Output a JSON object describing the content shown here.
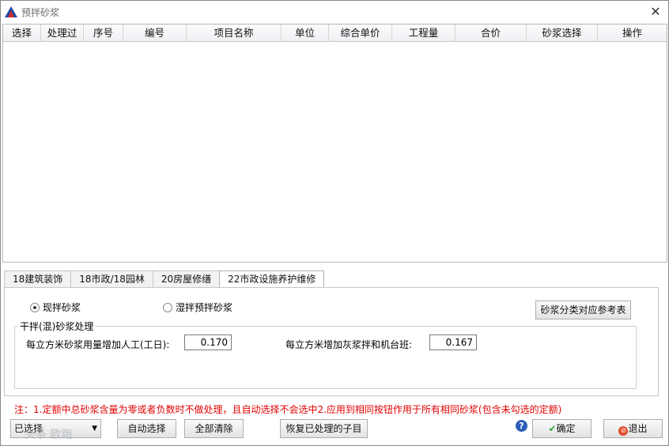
{
  "window": {
    "title": "预拌砂浆",
    "close_glyph": "✕"
  },
  "grid": {
    "columns": [
      "选择",
      "处理过",
      "序号",
      "编号",
      "项目名称",
      "单位",
      "综合单价",
      "工程量",
      "合价",
      "砂浆选择",
      "操作"
    ]
  },
  "tabs": [
    {
      "label": "18建筑装饰",
      "active": false
    },
    {
      "label": "18市政/18园林",
      "active": false
    },
    {
      "label": "20房屋修缮",
      "active": false
    },
    {
      "label": "22市政设施养护维修",
      "active": true
    }
  ],
  "panel": {
    "radio_site_mix": {
      "label": "现拌砂浆",
      "checked": true
    },
    "radio_wet_mix": {
      "label": "湿拌预拌砂浆",
      "checked": false
    },
    "reference_button": "砂浆分类对应参考表",
    "dry_mix_group": {
      "title": "干拌(混)砂浆处理",
      "labor_label": "每立方米砂浆用量增加人工(工日):",
      "labor_value": "0.170",
      "machine_label": "每立方米增加灰浆拌和机台班:",
      "machine_value": "0.167"
    }
  },
  "note": "注：1.定额中总砂浆含量为零或者负数时不做处理，且自动选择不会选中2.应用到相同按钮作用于所有相同砂浆(包含未勾选的定额)",
  "footer": {
    "selected_dropdown": "已选择",
    "auto_select": "自动选择",
    "clear_all": "全部清除",
    "restore_processed": "恢复已处理的子目",
    "help_glyph": "?",
    "confirm": "确定",
    "exit": "退出"
  },
  "watermark": "头条 欧跑",
  "colors": {
    "note_red": "#e00000",
    "confirm_check": "#3aa53a",
    "exit_icon": "#e04a2a"
  }
}
